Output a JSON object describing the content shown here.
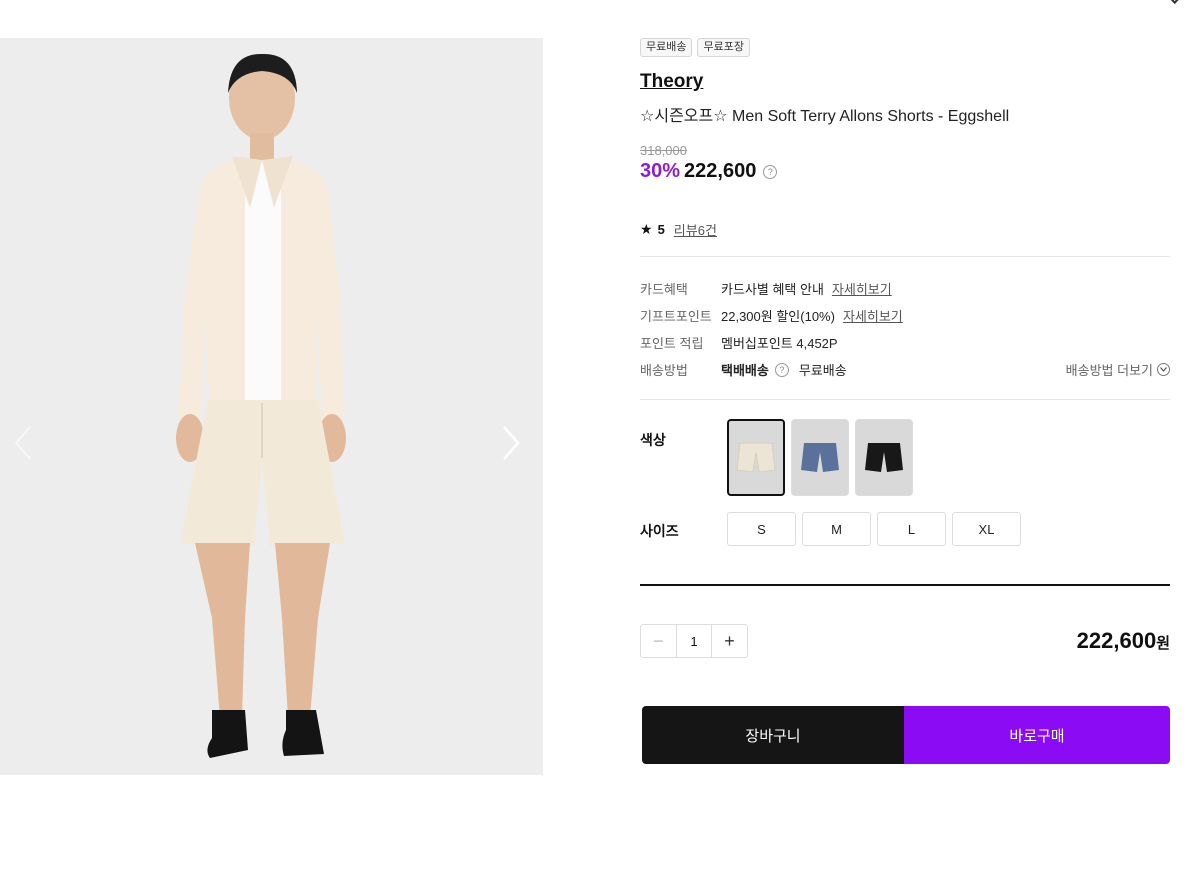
{
  "product": {
    "badges": [
      "무료배송",
      "무료포장"
    ],
    "brand": "Theory",
    "name": "☆시즌오프☆ Men Soft Terry Allons Shorts - Eggshell",
    "original_price": "318,000",
    "discount": "30%",
    "sale_price": "222,600",
    "rating": "5",
    "review_text": "리뷰6건"
  },
  "info": {
    "card_label": "카드혜택",
    "card_value": "카드사별 혜택 안내",
    "card_link": "자세히보기",
    "gift_label": "기프트포인트",
    "gift_value": "22,300원 할인(10%)",
    "gift_link": "자세히보기",
    "point_label": "포인트 적립",
    "point_value": "멤버십포인트 4,452P",
    "ship_label": "배송방법",
    "ship_method": "택배배송",
    "ship_free": "무료배송",
    "ship_more": "배송방법 더보기"
  },
  "options": {
    "color_label": "색상",
    "colors": [
      {
        "name": "eggshell",
        "hex": "#ece4d4"
      },
      {
        "name": "blue",
        "hex": "#5a729b"
      },
      {
        "name": "black",
        "hex": "#181818"
      }
    ],
    "size_label": "사이즈",
    "sizes": [
      "S",
      "M",
      "L",
      "XL"
    ]
  },
  "order": {
    "quantity": "1",
    "total_price": "222,600",
    "currency": "원",
    "cart_label": "장바구니",
    "buy_label": "바로구매"
  },
  "colors": {
    "accent_purple": "#8b0bf5",
    "discount_purple": "#8a1fd0"
  }
}
